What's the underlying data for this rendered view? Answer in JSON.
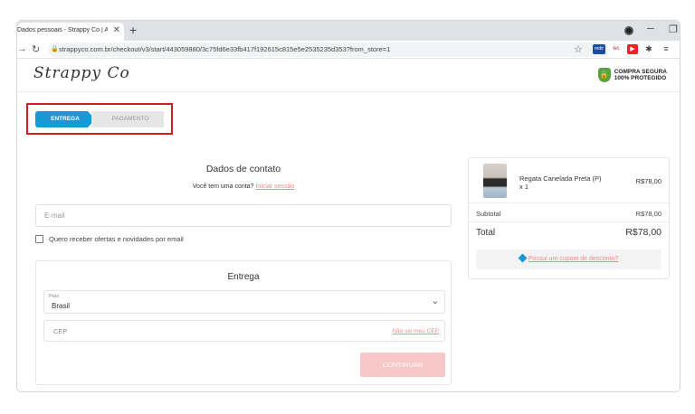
{
  "browser": {
    "tab_title": "Dados pessoais - Strappy Co | A",
    "close_glyph": "✕",
    "new_tab_glyph": "+",
    "url": "strappyco.com.br/checkout/v3/start/443059880/3c75fd6e33fb417f192615c815e5e2535235d353?from_store=1",
    "ext_redir": "redir",
    "ext_wc": "wc"
  },
  "header": {
    "logo": "Strappy Co",
    "secure_line1": "COMPRA SEGURA",
    "secure_line2": "100% PROTEGIDO"
  },
  "steps": {
    "active": "ENTREGA",
    "inactive": "PAGAMENTO"
  },
  "contact": {
    "title": "Dados de contato",
    "account_question": "Você tem uma conta?",
    "login_link": "Iniciar sessão",
    "email_placeholder": "E-mail",
    "newsletter_label": "Quero receber ofertas e novidades por email"
  },
  "delivery": {
    "title": "Entrega",
    "country_label": "País",
    "country_value": "Brasil",
    "cep_placeholder": "CEP",
    "cep_link": "Não sei meu CEP",
    "continue_label": "CONTINUAR"
  },
  "summary": {
    "product_name": "Regata Canelada Preta (P)",
    "product_qty": "x 1",
    "product_price": "R$78,00",
    "subtotal_label": "Subtotal",
    "subtotal_value": "R$78,00",
    "total_label": "Total",
    "total_value": "R$78,00",
    "coupon_link": "Possui um cupom de desconto?"
  },
  "colors": {
    "accent": "#1a98d5",
    "link": "#f08a8a",
    "button_disabled": "#f8c6c6",
    "highlight_border": "#cc1f1f"
  }
}
